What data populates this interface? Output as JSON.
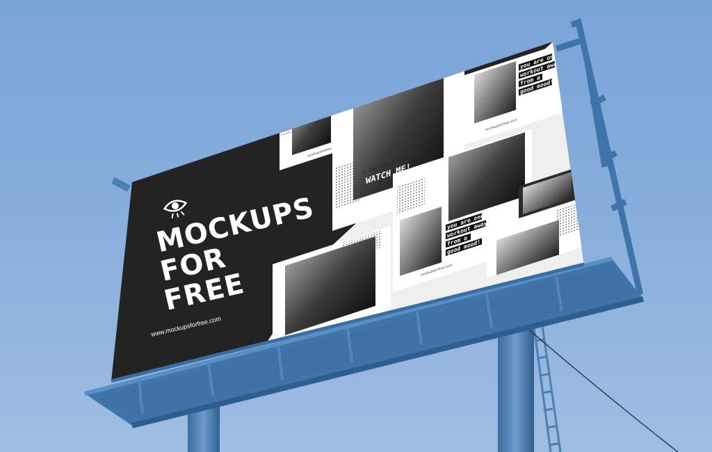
{
  "billboard": {
    "brand_line_1": "MOCKUPS",
    "brand_line_2": "FOR",
    "brand_line_3": "FREE",
    "website": "www.mockupsforfree.com",
    "logo_icon": "eye-icon"
  },
  "story_cards": {
    "site": "mockupsforfree.com",
    "quote_1": "you are one",
    "quote_2": "workout away",
    "quote_3": "from a",
    "quote_4": "good mood!",
    "small_text": "I can and I will",
    "watch_line": "WATCH ME!"
  },
  "colors": {
    "sky_top": "#7aa4d6",
    "sky_bottom": "#9ebde2",
    "board_black": "#232323",
    "structure_blue": "#4a7fb4"
  }
}
